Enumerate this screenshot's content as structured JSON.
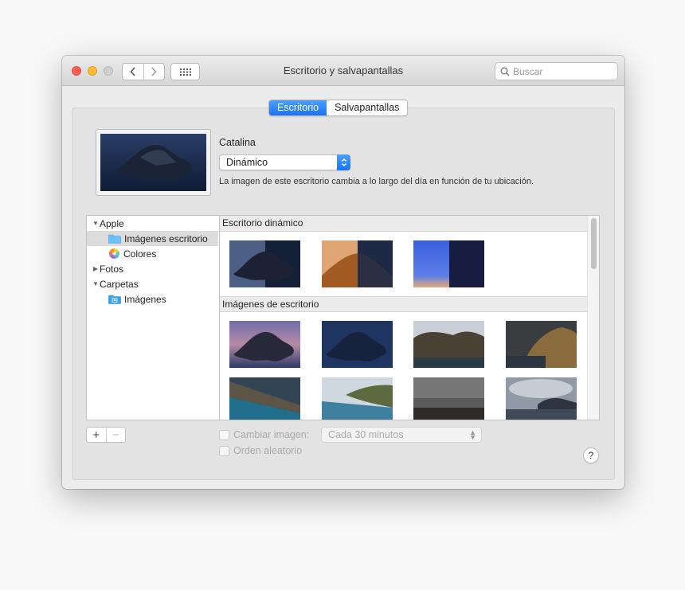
{
  "window": {
    "title": "Escritorio y salvapantallas",
    "search_placeholder": "Buscar"
  },
  "toolbar": {
    "back_icon": "chevron-left-icon",
    "forward_icon": "chevron-right-icon",
    "grid_icon": "grid-icon",
    "search_icon": "search-icon"
  },
  "tabs": [
    {
      "label": "Escritorio",
      "active": true
    },
    {
      "label": "Salvapantallas",
      "active": false
    }
  ],
  "wallpaper": {
    "name": "Catalina",
    "mode": "Dinámico",
    "description": "La imagen de este escritorio cambia a lo largo del día en función de tu ubicación."
  },
  "sidebar": {
    "items": [
      {
        "label": "Apple",
        "disclosure": "expanded",
        "level": 0
      },
      {
        "label": "Imágenes escritorio",
        "icon": "folder-icon",
        "level": 1,
        "selected": true
      },
      {
        "label": "Colores",
        "icon": "color-wheel-icon",
        "level": 1
      },
      {
        "label": "Fotos",
        "disclosure": "collapsed",
        "level": 0
      },
      {
        "label": "Carpetas",
        "disclosure": "expanded",
        "level": 0
      },
      {
        "label": "Imágenes",
        "icon": "pictures-folder-icon",
        "level": 1
      }
    ]
  },
  "content": {
    "sections": [
      {
        "title": "Escritorio dinámico"
      },
      {
        "title": "Imágenes de escritorio"
      }
    ]
  },
  "bottom": {
    "add_label": "+",
    "remove_label": "−",
    "change_picture_label": "Cambiar imagen:",
    "interval_value": "Cada 30 minutos",
    "random_order_label": "Orden aleatorio",
    "help_label": "?"
  },
  "colors": {
    "accent": "#1a73f4",
    "selection": "#dcdcdc"
  }
}
